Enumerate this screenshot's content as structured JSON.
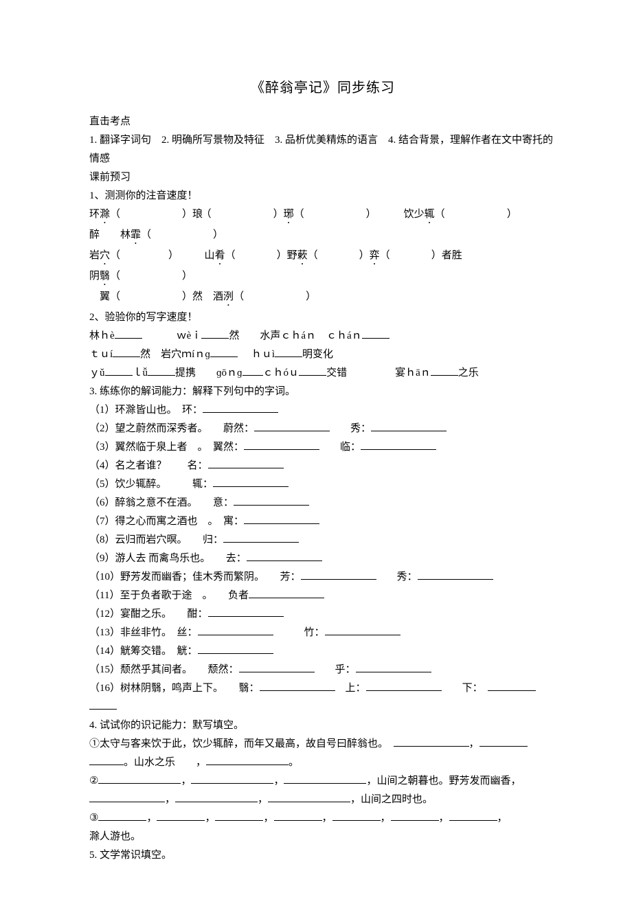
{
  "title": "《醉翁亭记》同步练习",
  "h_zhiji": "直击考点",
  "zhiji_line": "1. 翻译字词句　2. 明确所写景物及特征　3. 品析优美精炼的语言　4. 结合背景，理解作者在文中寄托的情感",
  "h_yuxi": "课前预习",
  "q1": "1、测测你的注音速度！",
  "q1a": {
    "a": "环",
    "b": "滁",
    "c": "（",
    "d": "）琅",
    "e": "（",
    "f": "）",
    "g": "琊",
    "h": "（",
    "i": "）",
    "j": "饮少",
    "k": "辄",
    "l": "（",
    "m": "）"
  },
  "q1b": {
    "a": "醉　　林",
    "b": "霏",
    "c": "（",
    "d": "）"
  },
  "q1c": {
    "a": "岩",
    "b": "穴",
    "c": "（",
    "d": "）　　　山",
    "e": "肴",
    "f": "（",
    "g": "）野",
    "h": "蔌",
    "i": "（",
    "j": "）",
    "k": "弈",
    "l": "（",
    "m": "）者胜"
  },
  "q1d": {
    "a": "阴",
    "b": "翳",
    "c": "（",
    "d": "）"
  },
  "q1e": {
    "a": "　翼",
    "b": "（",
    "c": "）然　酒",
    "d": "洌",
    "e": "（",
    "f": "）"
  },
  "q2": "2、验验你的写字速度！",
  "q2a": "林ｈè",
  "q2a2": "ｗèｉ",
  "q2a3": "然　　水声ｃｈáｎ　ｃｈáｎ",
  "q2b": "ｔｕí",
  "q2b2": "然　岩穴ｍíｎɡ",
  "q2b3": "ｈｕì",
  "q2b4": "明变化",
  "q2c": "ｙǔ",
  "q2c2": "ｌǚ",
  "q2c3": "提携　　ɡōｎɡ",
  "q2c4": "ｃｈóｕ",
  "q2c5": "交错",
  "q2c6": "宴ｈāｎ",
  "q2c7": "之乐",
  "q3": "3. 练练你的解词能力：解释下列句中的字词。",
  "i01": "（1）环滁皆山也。　环：",
  "i02": "（2）望之蔚然而深秀者。　　蔚然：",
  "i02b": "秀：",
  "i03": "（3）翼然临于泉上者　。　翼然：",
  "i03b": "临：",
  "i04": "（4）名之者谁？　　名：",
  "i05": "（5）饮少辄醉。　　　辄：",
  "i06": "（6）醉翁之意不在酒。　　意：",
  "i07": "（7）得之心而寓之酒也　。　寓：",
  "i08": "（8）云归而岩穴暝。　　归：",
  "i09": "（9）游人去  而禽鸟乐也。　　去：",
  "i10": "（10）野芳发而幽香；佳木秀而繁阴。　　芳：",
  "i10b": "秀：",
  "i11": "（11）至于负者歌于途　。　　负者",
  "i12": "（12）宴酣之乐。　　酣：",
  "i13": "（13）非丝非竹。　丝：",
  "i13b": "竹：",
  "i14": "（14）觥筹交错。　觥：",
  "i15": "（15）颓然乎其间者。　　颓然：",
  "i15b": "乎：",
  "i16": "（16）树林阴翳，鸣声上下。　　翳：",
  "i16b": "上：",
  "i16c": "下：",
  "q4": "4. 试试你的识记能力：默写填空。",
  "q4a": "①太守与客来饮于此，饮少辄醉，而年又最高，故自号曰醉翁也。",
  "q4a2": "，",
  "q4a3": "。山水之乐　　，",
  "q4a4": "。",
  "q4b": "②",
  "q4b2": "，",
  "q4b3": "，",
  "q4b4": "，山间之朝暮也。野芳发而幽香，",
  "q4b5": "，",
  "q4b6": "，",
  "q4b7": "，山间之四时也。",
  "q4c": "③",
  "q4c2": "，",
  "q4c3": "，",
  "q4c4": "，",
  "q4c5": "，",
  "q4c6": "，",
  "q4c7": "，",
  "q4c8": "，",
  "q4d": "滁人游也。",
  "q5": "5. 文学常识填空。"
}
